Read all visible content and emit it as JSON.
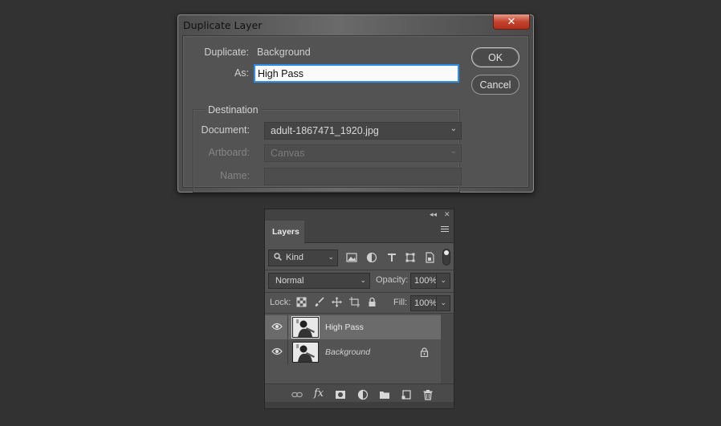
{
  "dialog": {
    "title": "Duplicate Layer",
    "close_glyph": "✕",
    "duplicate_label": "Duplicate:",
    "duplicate_value": "Background",
    "as_label": "As:",
    "as_value": "High Pass",
    "destination_title": "Destination",
    "document_label": "Document:",
    "document_value": "adult-1867471_1920.jpg",
    "artboard_label": "Artboard:",
    "artboard_value": "Canvas",
    "name_label": "Name:",
    "name_value": "",
    "ok_label": "OK",
    "cancel_label": "Cancel"
  },
  "layers_panel": {
    "collapse_glyph": "◂◂",
    "close_glyph": "✕",
    "tab_label": "Layers",
    "filter_kind": "Kind",
    "blend_mode": "Normal",
    "opacity_label": "Opacity:",
    "opacity_value": "100%",
    "lock_label": "Lock:",
    "fill_label": "Fill:",
    "fill_value": "100%",
    "layers": [
      {
        "name": "High Pass",
        "selected": true,
        "locked": false
      },
      {
        "name": "Background",
        "selected": false,
        "locked": true
      }
    ],
    "fx_label": "fx"
  },
  "colors": {
    "accent_focus": "#2f8fe8",
    "close_button": "#c4432e",
    "panel_bg": "#535353",
    "page_bg": "#323232"
  }
}
